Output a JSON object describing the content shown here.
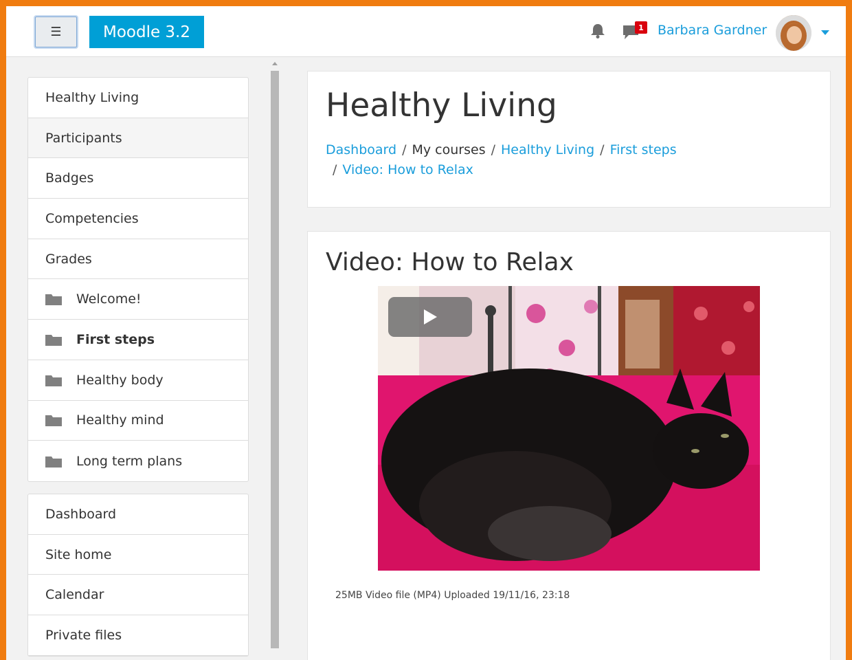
{
  "navbar": {
    "menu_icon_glyph": "☰",
    "brand": "Moodle 3.2",
    "notification_count": "1",
    "user_name": "Barbara Gardner"
  },
  "sidebar": {
    "course_nav": [
      {
        "label": "Healthy Living",
        "icon": null
      },
      {
        "label": "Participants",
        "icon": null
      },
      {
        "label": "Badges",
        "icon": null
      },
      {
        "label": "Competencies",
        "icon": null
      },
      {
        "label": "Grades",
        "icon": null
      },
      {
        "label": "Welcome!",
        "icon": "folder-icon"
      },
      {
        "label": "First steps",
        "icon": "folder-icon"
      },
      {
        "label": "Healthy body",
        "icon": "folder-icon"
      },
      {
        "label": "Healthy mind",
        "icon": "folder-icon"
      },
      {
        "label": "Long term plans",
        "icon": "folder-icon"
      }
    ],
    "site_nav": [
      {
        "label": "Dashboard"
      },
      {
        "label": "Site home"
      },
      {
        "label": "Calendar"
      },
      {
        "label": "Private files"
      }
    ]
  },
  "header": {
    "title": "Healthy Living",
    "breadcrumb": [
      {
        "label": "Dashboard",
        "link": true
      },
      {
        "label": "My courses",
        "link": false
      },
      {
        "label": "Healthy Living",
        "link": true
      },
      {
        "label": "First steps",
        "link": true
      },
      {
        "label": "Video: How to Relax",
        "link": true
      }
    ],
    "separator": "/"
  },
  "content": {
    "title": "Video: How to Relax",
    "video_meta": "25MB Video file (MP4) Uploaded 19/11/16, 23:18"
  },
  "colors": {
    "accent": "#f07c10",
    "brand": "#009fd6",
    "link": "#1a9ddb",
    "badge": "#d9000d"
  }
}
